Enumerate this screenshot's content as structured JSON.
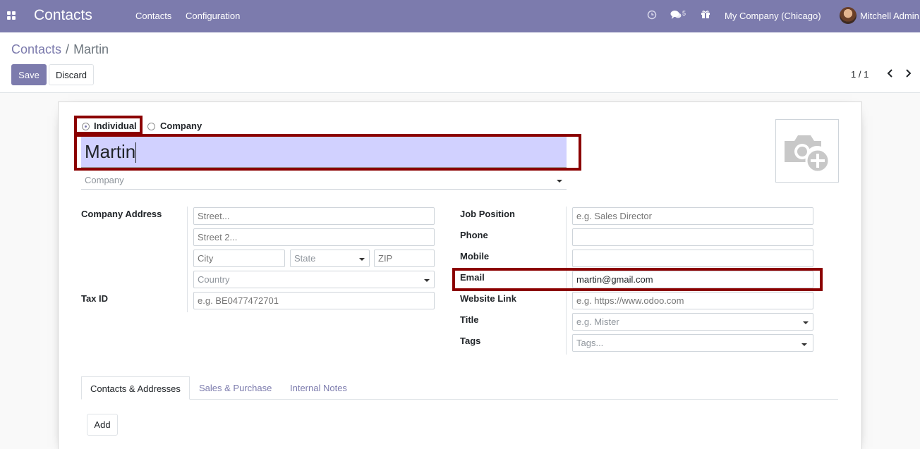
{
  "navbar": {
    "app_title": "Contacts",
    "menu": [
      "Contacts",
      "Configuration"
    ],
    "messages_count": "5",
    "company": "My Company (Chicago)",
    "user": "Mitchell Admin",
    "icons": [
      "apps-grid-icon",
      "clock-icon",
      "chat-icon",
      "gift-icon"
    ]
  },
  "breadcrumb": {
    "parent": "Contacts",
    "separator": "/",
    "current": "Martin"
  },
  "actions": {
    "save": "Save",
    "discard": "Discard"
  },
  "pager": {
    "value": "1 / 1"
  },
  "form": {
    "type_options": [
      "Individual",
      "Company"
    ],
    "type_selected": "Individual",
    "name": "Martin",
    "company_placeholder": "Company",
    "left_labels": {
      "address": "Company Address",
      "vat": "Tax ID"
    },
    "address": {
      "street": "Street...",
      "street2": "Street 2...",
      "city": "City",
      "state": "State",
      "zip": "ZIP",
      "country": "Country"
    },
    "vat_placeholder": "e.g. BE0477472701",
    "right_labels": {
      "job": "Job Position",
      "phone": "Phone",
      "mobile": "Mobile",
      "email": "Email",
      "website": "Website Link",
      "title": "Title",
      "tags": "Tags"
    },
    "right_values": {
      "job_placeholder": "e.g. Sales Director",
      "phone": "",
      "mobile": "",
      "email": "martin@gmail.com",
      "website_placeholder": "e.g. https://www.odoo.com",
      "title_placeholder": "e.g. Mister",
      "tags_placeholder": "Tags..."
    }
  },
  "notebook": {
    "tabs": [
      "Contacts & Addresses",
      "Sales & Purchase",
      "Internal Notes"
    ],
    "active_tab": "Contacts & Addresses",
    "add_button": "Add"
  },
  "colors": {
    "navbar": "#7c7bad",
    "primary": "#7c7bad",
    "highlight": "#8b0000",
    "name_bg": "#d1d1ff"
  }
}
